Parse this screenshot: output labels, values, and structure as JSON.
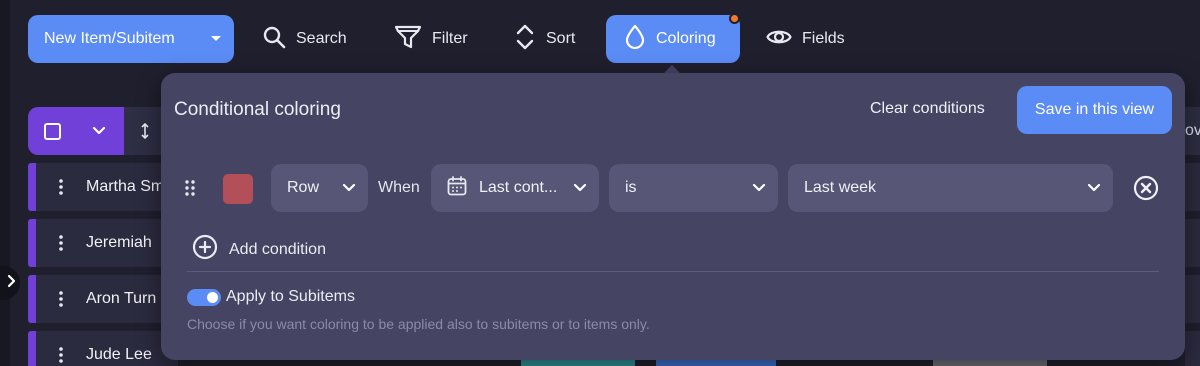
{
  "toolbar": {
    "new_item_label": "New Item/Subitem",
    "search_label": "Search",
    "filter_label": "Filter",
    "sort_label": "Sort",
    "coloring_label": "Coloring",
    "fields_label": "Fields"
  },
  "table": {
    "rows": [
      {
        "name": "Martha Sm"
      },
      {
        "name": "Jeremiah"
      },
      {
        "name": "Aron Turn"
      },
      {
        "name": "Jude Lee"
      }
    ],
    "right_header_partial": "ove"
  },
  "coloring_panel": {
    "title": "Conditional coloring",
    "clear_label": "Clear conditions",
    "save_label": "Save in this view",
    "condition": {
      "swatch_color": "#b24f58",
      "scope": "Row",
      "when_label": "When",
      "field": "Last cont...",
      "operator": "is",
      "value": "Last week"
    },
    "add_condition_label": "Add condition",
    "apply_label": "Apply to Subitems",
    "apply_enabled": true,
    "hint": "Choose if you want coloring to be applied also to subitems or to items only."
  },
  "colors": {
    "accent": "#5b8cf5",
    "header_purple": "#7140d8",
    "panel_bg": "#454463",
    "notification": "#ef7b2a"
  }
}
